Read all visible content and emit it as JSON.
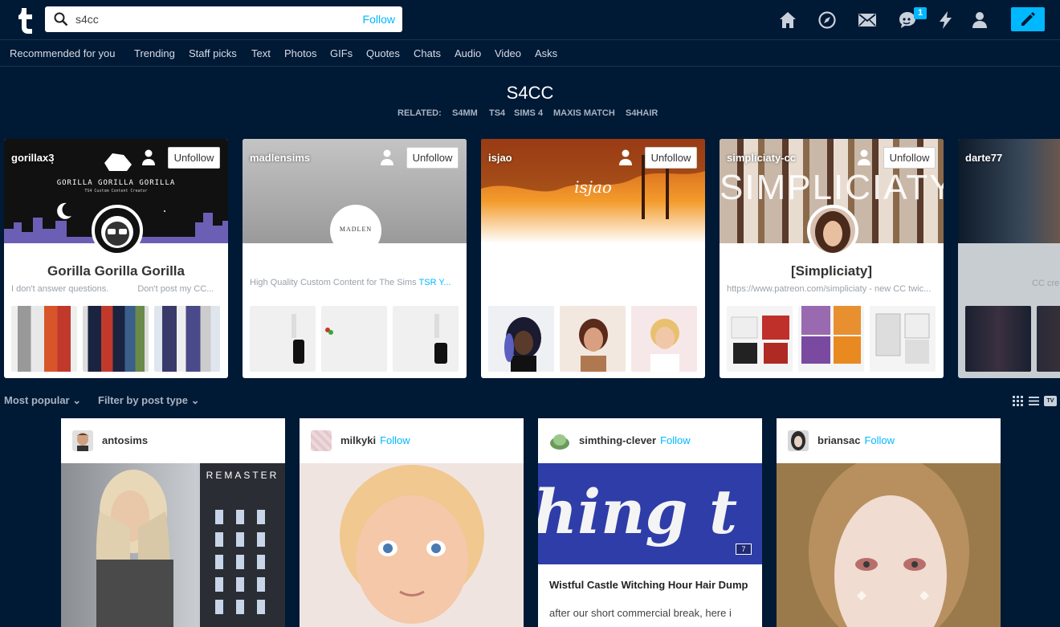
{
  "search": {
    "query": "s4cc",
    "follow_label": "Follow"
  },
  "nav": {
    "messages_badge": "1"
  },
  "tabs": [
    "Recommended for you",
    "Trending",
    "Staff picks",
    "Text",
    "Photos",
    "GIFs",
    "Quotes",
    "Chats",
    "Audio",
    "Video",
    "Asks"
  ],
  "page": {
    "title": "S4CC",
    "related_label": "RELATED:",
    "related": [
      "S4MM",
      "TS4",
      "SIMS 4",
      "MAXIS MATCH",
      "S4HAIR"
    ]
  },
  "cards": [
    {
      "name": "gorillax3",
      "button": "Unfollow",
      "title": "Gorilla Gorilla Gorilla",
      "banner_title": "GORILLA GORILLA GORILLA",
      "banner_sub": "TS4 Custom Content Creator",
      "desc": "I don't answer questions.",
      "desc2": "Don't post my CC..."
    },
    {
      "name": "madlensims",
      "button": "Unfollow",
      "title": "",
      "avatar_text": "MADLEN",
      "desc": "High Quality Custom Content for The Sims",
      "desc_link": "TSR Y..."
    },
    {
      "name": "isjao",
      "button": "Unfollow",
      "banner_title": "isjao"
    },
    {
      "name": "simpliciaty-cc",
      "button": "Unfollow",
      "banner_title": "SIMPLICIATY",
      "title": "[Simpliciaty]",
      "desc": "https://www.patreon.com/simpliciaty - new CC twic..."
    },
    {
      "name": "darte77",
      "desc": "CC cre"
    }
  ],
  "filters": {
    "sort": "Most popular",
    "type": "Filter by post type",
    "tv_label": "TV"
  },
  "posts": [
    {
      "user": "antosims",
      "follow": "",
      "overlay": "REMASTER"
    },
    {
      "user": "milkyki",
      "follow": "Follow"
    },
    {
      "user": "simthing-clever",
      "follow": "Follow",
      "img_text": "hing t",
      "count": "7",
      "title": "Wistful Castle Witching Hour Hair Dump",
      "body": "after our short commercial break, here i"
    },
    {
      "user": "briansac",
      "follow": "Follow"
    }
  ],
  "colors": {
    "bg": "#001935",
    "accent": "#00b8ff"
  }
}
